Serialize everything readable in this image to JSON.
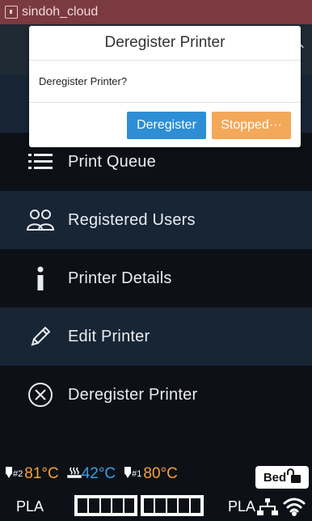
{
  "statusbar": {
    "app_title": "sindoh_cloud"
  },
  "dialog": {
    "title": "Deregister Printer",
    "message": "Deregister Printer?",
    "primary_label": "Deregister",
    "secondary_label": "Stopped···"
  },
  "menu": {
    "items": [
      {
        "label": "Print Queue",
        "icon": "list-icon"
      },
      {
        "label": "Registered Users",
        "icon": "users-icon"
      },
      {
        "label": "Printer Details",
        "icon": "info-icon"
      },
      {
        "label": "Edit Printer",
        "icon": "pencil-icon"
      },
      {
        "label": "Deregister Printer",
        "icon": "circle-x-icon"
      }
    ]
  },
  "footer": {
    "temps": [
      {
        "sub": "#2",
        "value": "81°C",
        "color": "#f5a23b"
      },
      {
        "sub": "",
        "value": "42°C",
        "color": "#3aa0e6"
      },
      {
        "sub": "#1",
        "value": "80°C",
        "color": "#f5a23b"
      }
    ],
    "bed_label": "Bed",
    "material_left": "PLA",
    "material_right": "PLA"
  },
  "colors": {
    "statusbar": "#7a3a3f",
    "primary": "#2d8ed6",
    "stopped": "#f3a85a",
    "background": "#0d1117",
    "row_alt": "#182534"
  }
}
